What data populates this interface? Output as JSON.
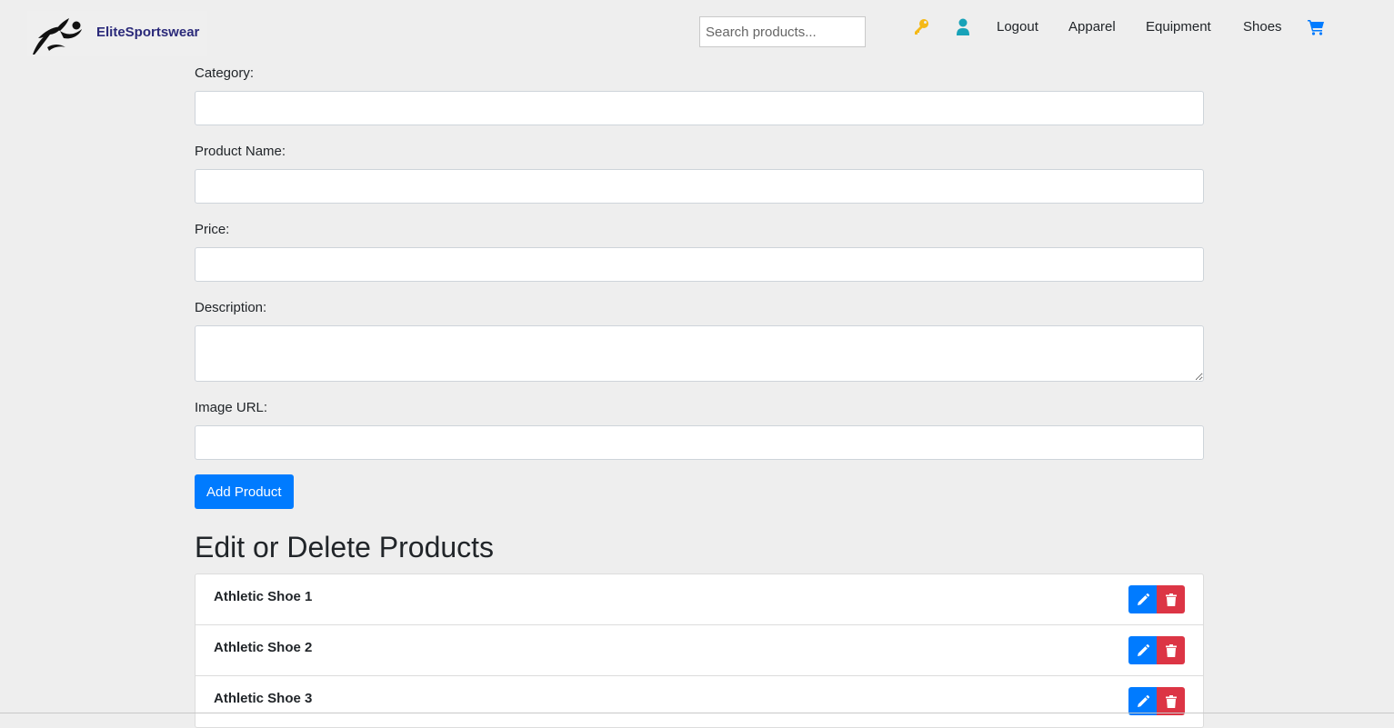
{
  "brand": {
    "name": "EliteSportswear",
    "logo_icon": "runner-icon"
  },
  "header": {
    "search_placeholder": "Search products...",
    "search_value": "",
    "icons": {
      "admin": "key-icon",
      "profile": "user-icon",
      "cart": "cart-icon"
    },
    "nav_links": [
      "Logout",
      "Apparel",
      "Equipment",
      "Shoes"
    ],
    "colors": {
      "key": "#f5b916",
      "user": "#17a2b8",
      "cart": "#007bff"
    }
  },
  "form": {
    "fields": [
      {
        "label": "Category:",
        "value": ""
      },
      {
        "label": "Product Name:",
        "value": ""
      },
      {
        "label": "Price:",
        "value": ""
      },
      {
        "label": "Description:",
        "value": ""
      },
      {
        "label": "Image URL:",
        "value": ""
      }
    ],
    "submit_label": "Add Product"
  },
  "products_section": {
    "title": "Edit or Delete Products",
    "items": [
      {
        "name": "Athletic Shoe 1"
      },
      {
        "name": "Athletic Shoe 2"
      },
      {
        "name": "Athletic Shoe 3"
      }
    ],
    "edit_icon": "pencil-icon",
    "delete_icon": "trash-icon",
    "colors": {
      "edit": "#007bff",
      "delete": "#dc3545"
    }
  }
}
